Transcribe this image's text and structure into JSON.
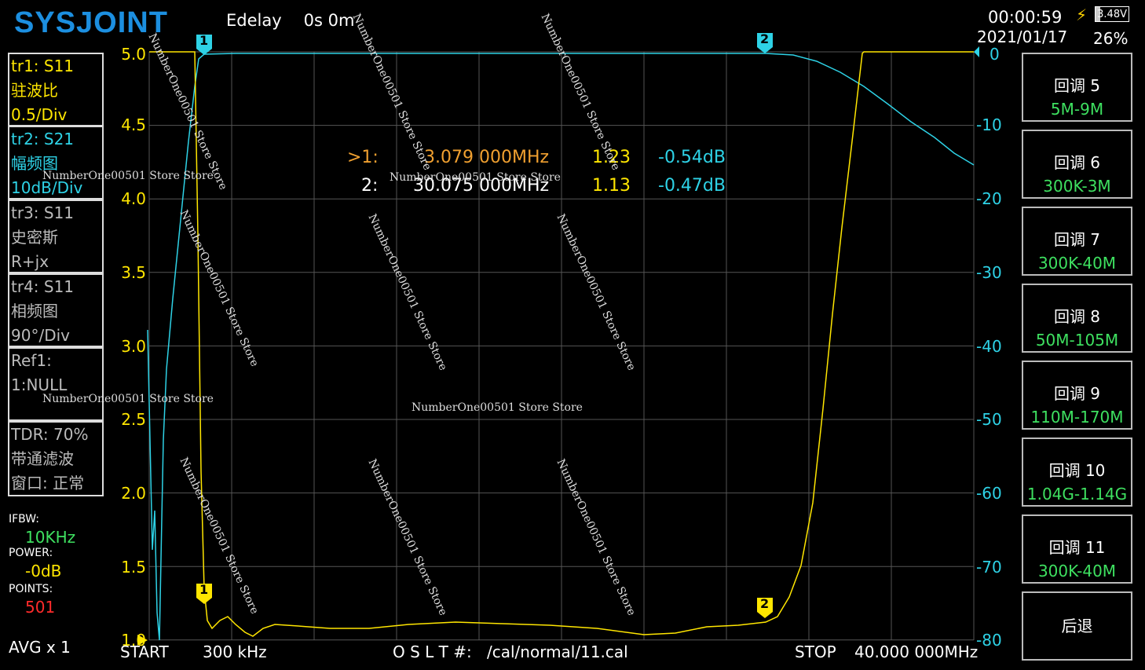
{
  "header": {
    "logo": "SYSJOINT",
    "edelay_label": "Edelay",
    "edelay_value": "0s 0m",
    "time": "00:00:59",
    "date": "2021/01/17",
    "battery_voltage": "3.48V",
    "battery_percent": "26%"
  },
  "traces": [
    {
      "line1": "tr1:   S11",
      "line2": "驻波比",
      "line3": "0.5/Div"
    },
    {
      "line1": "tr2:   S21",
      "line2": "幅频图",
      "line3": "10dB/Div"
    },
    {
      "line1": "tr3:   S11",
      "line2": "史密斯",
      "line3": "R+jx"
    },
    {
      "line1": "tr4:   S11",
      "line2": "相频图",
      "line3": "90°/Div"
    },
    {
      "line1": "Ref1:",
      "line2": "1:NULL",
      "line3": ""
    },
    {
      "line1": "TDR: 70%",
      "line2": "带通滤波",
      "line3": "窗口: 正常"
    }
  ],
  "params": {
    "ifbw_label": "IFBW:",
    "ifbw_value": "10KHz",
    "power_label": "POWER:",
    "power_value": "-0dB",
    "points_label": "POINTS:",
    "points_value": "501",
    "avg": "AVG x 1"
  },
  "axis_left": [
    "5.0",
    "4.5",
    "4.0",
    "3.5",
    "3.0",
    "2.5",
    "2.0",
    "1.5",
    "1.0"
  ],
  "axis_right": [
    "0",
    "-10",
    "-20",
    "-30",
    "-40",
    "-50",
    "-60",
    "-70",
    "-80"
  ],
  "markers": [
    {
      "id": ">1:",
      "freq": "3.079 000MHz",
      "vswr": "1.23",
      "db": "-0.54dB"
    },
    {
      "id": "2:",
      "freq": "30.075 000MHz",
      "vswr": "1.13",
      "db": "-0.47dB"
    }
  ],
  "marker_tags": {
    "m1": "1",
    "m2": "2"
  },
  "softkeys": [
    {
      "title": "回调 5",
      "sub": "5M-9M"
    },
    {
      "title": "回调 6",
      "sub": "300K-3M"
    },
    {
      "title": "回调 7",
      "sub": "300K-40M"
    },
    {
      "title": "回调 8",
      "sub": "50M-105M"
    },
    {
      "title": "回调 9",
      "sub": "110M-170M"
    },
    {
      "title": "回调 10",
      "sub": "1.04G-1.14G"
    },
    {
      "title": "回调 11",
      "sub": "300K-40M"
    },
    {
      "title": "后退",
      "sub": ""
    }
  ],
  "footer": {
    "start_label": "START",
    "start_value": "300 kHz",
    "cal_label": "O S L T #:",
    "cal_file": "/cal/normal/11.cal",
    "stop_label": "STOP",
    "stop_value": "40.000 000MHz"
  },
  "watermark": "NumberOne00501 Store Store",
  "colors": {
    "vswr_trace": "#ffe600",
    "s21_trace": "#2ed2e6",
    "grid": "#555555",
    "softkey_sub": "#3ee060"
  }
}
